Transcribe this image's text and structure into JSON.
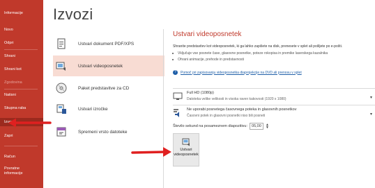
{
  "sidebar": {
    "items": [
      {
        "label": "Informacije"
      },
      {
        "label": "Novo"
      },
      {
        "label": "Odpri"
      },
      {
        "label": "Shrani"
      },
      {
        "label": "Shrani kot"
      },
      {
        "label": "Zgodovina"
      },
      {
        "label": "Natisni"
      },
      {
        "label": "Skupna raba"
      },
      {
        "label": "Izvozi"
      },
      {
        "label": "Zapri"
      },
      {
        "label": "Račun"
      },
      {
        "label": "Povratne informacije"
      }
    ]
  },
  "page": {
    "title": "Izvozi"
  },
  "export_options": [
    {
      "label": "Ustvari dokument PDF/XPS",
      "icon": "pdf-document-icon"
    },
    {
      "label": "Ustvari videoposnetek",
      "icon": "video-icon"
    },
    {
      "label": "Paket predstavitve za CD",
      "icon": "cd-icon"
    },
    {
      "label": "Ustvari izročke",
      "icon": "handouts-icon"
    },
    {
      "label": "Spremeni vrsto datoteke",
      "icon": "file-type-icon"
    }
  ],
  "video_panel": {
    "title": "Ustvari videoposnetek",
    "description": "Shranite predstavitev kot videoposnetek, ki ga lahko zapišete na disk, prenesete v splet ali pošljete po e-pošti.",
    "bullets": [
      "Vključuje vse posnete čase, glasovne posnetke, poteze rokopisa in premike laserskega kazalnika",
      "Ohrani animacije, prehode in predstavnosti"
    ],
    "help_link": "Pomoč pri zapisovanju videoposnetka diaprojekcije na DVD ali prenosu v splet",
    "quality": {
      "main": "Full HD (1080p)",
      "sub": "Datoteka velike velikosti in visoka raven kakovosti (1920 x 1080)"
    },
    "narration": {
      "main": "Ne uporabi posnetega časovnega poteka in glasovnih posnetkov",
      "sub": "Časovni potek in glasovni posnetki niso bili posneti"
    },
    "seconds_label": "Število sekund na posameznem diapozitivu:",
    "seconds_value": "05,00",
    "create_button": {
      "line1": "Ustvari",
      "line2": "videoposnetek"
    }
  },
  "colors": {
    "accent": "#c0392b",
    "selected_bg": "#f8dcd3",
    "arrow": "#e02020"
  }
}
